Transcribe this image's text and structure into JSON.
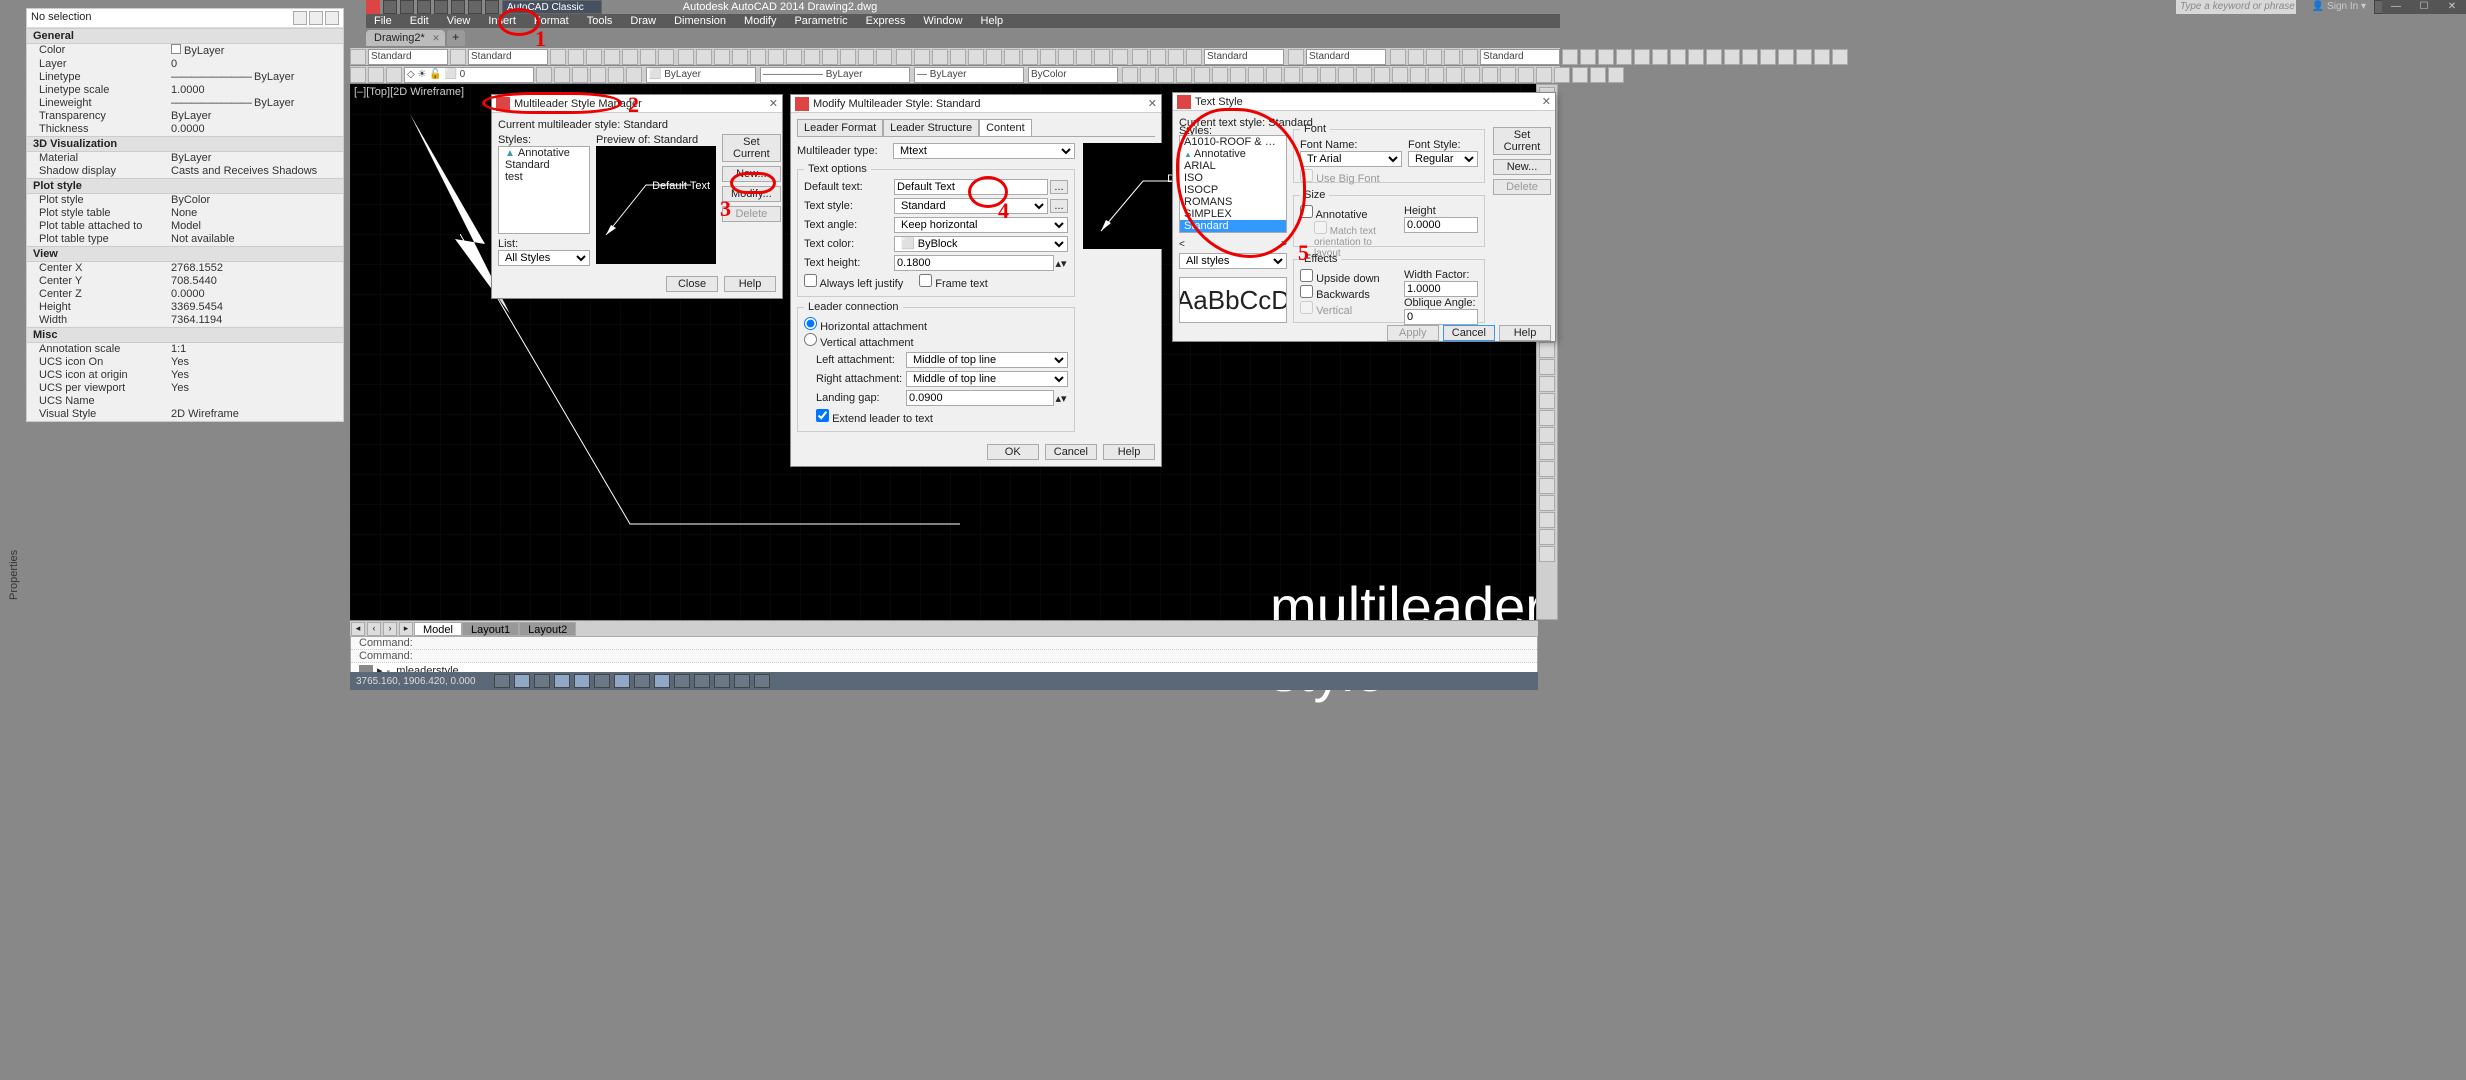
{
  "app": {
    "title": "Autodesk AutoCAD 2014   Drawing2.dwg",
    "workspace": "AutoCAD Classic",
    "search_placeholder": "Type a keyword or phrase",
    "signin": "Sign In"
  },
  "menu": [
    "File",
    "Edit",
    "View",
    "Insert",
    "Format",
    "Tools",
    "Draw",
    "Dimension",
    "Modify",
    "Parametric",
    "Express",
    "Window",
    "Help"
  ],
  "doc_tab": "Drawing2*",
  "toolbar": {
    "style_selects": [
      "Standard",
      "Standard",
      "Standard",
      "Standard",
      "Standard"
    ],
    "layer": "0",
    "bylayer": "ByLayer",
    "bylayer2": "ByLayer",
    "bylayer3": "ByLayer",
    "bycolor": "ByColor"
  },
  "viewport_label": "[–][Top][2D Wireframe]",
  "props": {
    "selection": "No selection",
    "groups": [
      {
        "name": "General",
        "rows": [
          [
            "Color",
            "ByLayer"
          ],
          [
            "Layer",
            "0"
          ],
          [
            "Linetype",
            "ByLayer"
          ],
          [
            "Linetype scale",
            "1.0000"
          ],
          [
            "Lineweight",
            "ByLayer"
          ],
          [
            "Transparency",
            "ByLayer"
          ],
          [
            "Thickness",
            "0.0000"
          ]
        ]
      },
      {
        "name": "3D Visualization",
        "rows": [
          [
            "Material",
            "ByLayer"
          ],
          [
            "Shadow display",
            "Casts and Receives Shadows"
          ]
        ]
      },
      {
        "name": "Plot style",
        "rows": [
          [
            "Plot style",
            "ByColor"
          ],
          [
            "Plot style table",
            "None"
          ],
          [
            "Plot table attached to",
            "Model"
          ],
          [
            "Plot table type",
            "Not available"
          ]
        ]
      },
      {
        "name": "View",
        "rows": [
          [
            "Center X",
            "2768.1552"
          ],
          [
            "Center Y",
            "708.5440"
          ],
          [
            "Center Z",
            "0.0000"
          ],
          [
            "Height",
            "3369.5454"
          ],
          [
            "Width",
            "7364.1194"
          ]
        ]
      },
      {
        "name": "Misc",
        "rows": [
          [
            "Annotation scale",
            "1:1"
          ],
          [
            "UCS icon On",
            "Yes"
          ],
          [
            "UCS icon at origin",
            "Yes"
          ],
          [
            "UCS per viewport",
            "Yes"
          ],
          [
            "UCS Name",
            ""
          ],
          [
            "Visual Style",
            "2D Wireframe"
          ]
        ]
      }
    ]
  },
  "props_side_label": "Properties",
  "model_tabs": [
    "Model",
    "Layout1",
    "Layout2"
  ],
  "cmdline": {
    "hist1": "Command:",
    "hist2": "Command:",
    "input": "-_mleaderstyle"
  },
  "statusbar_coords": "3765.160, 1906.420, 0.000",
  "big_text": "multileader style",
  "dlg_msm": {
    "title": "Multileader Style Manager",
    "current_label": "Current multileader style: Standard",
    "styles_label": "Styles:",
    "preview_label": "Preview of: Standard",
    "tree": [
      "Annotative",
      "Standard",
      "test"
    ],
    "list_label": "List:",
    "list_value": "All Styles",
    "preview_text": "Default Text",
    "btn_set_current": "Set Current",
    "btn_new": "New...",
    "btn_modify": "Modify...",
    "btn_delete": "Delete",
    "btn_close": "Close",
    "btn_help": "Help"
  },
  "dlg_modify": {
    "title": "Modify Multileader Style: Standard",
    "tabs": [
      "Leader Format",
      "Leader Structure",
      "Content"
    ],
    "active_tab": 2,
    "ml_type_label": "Multileader type:",
    "ml_type": "Mtext",
    "txt_options": "Text options",
    "default_text_label": "Default text:",
    "default_text": "Default Text",
    "text_style_label": "Text style:",
    "text_style": "Standard",
    "text_angle_label": "Text angle:",
    "text_angle": "Keep horizontal",
    "text_color_label": "Text color:",
    "text_color": "ByBlock",
    "text_height_label": "Text height:",
    "text_height": "0.1800",
    "always_left": "Always left justify",
    "frame_text": "Frame text",
    "leader_conn": "Leader connection",
    "horiz_attach": "Horizontal attachment",
    "vert_attach": "Vertical attachment",
    "left_attach_label": "Left attachment:",
    "left_attach": "Middle of top line",
    "right_attach_label": "Right attachment:",
    "right_attach": "Middle of top line",
    "landing_gap_label": "Landing gap:",
    "landing_gap": "0.0900",
    "extend_leader": "Extend leader to text",
    "preview_text": "Default Text",
    "btn_ok": "OK",
    "btn_cancel": "Cancel",
    "btn_help": "Help"
  },
  "dlg_textstyle": {
    "title": "Text Style",
    "current_label": "Current text style: Standard",
    "styles_label": "Styles:",
    "styles": [
      "A1010-ROOF & SITE PLA...",
      "Annotative",
      "ARIAL",
      "ISO",
      "ISOCP",
      "ROMANS",
      "SIMPLEX",
      "Standard"
    ],
    "selected_style": "Standard",
    "list_label": "All styles",
    "preview": "AaBbCcD",
    "font_group": "Font",
    "font_name_label": "Font Name:",
    "font_name": "Arial",
    "font_style_label": "Font Style:",
    "font_style": "Regular",
    "use_big_font": "Use Big Font",
    "size_group": "Size",
    "annotative": "Annotative",
    "match_orient": "Match text orientation to layout",
    "height_label": "Height",
    "height": "0.0000",
    "effects_group": "Effects",
    "upside_down": "Upside down",
    "backwards": "Backwards",
    "vertical": "Vertical",
    "width_factor_label": "Width Factor:",
    "width_factor": "1.0000",
    "oblique_label": "Oblique Angle:",
    "oblique": "0",
    "btn_set_current": "Set Current",
    "btn_new": "New...",
    "btn_delete": "Delete",
    "btn_apply": "Apply",
    "btn_cancel": "Cancel",
    "btn_help": "Help"
  },
  "annotations": {
    "n1": "1",
    "n2": "2",
    "n3": "3",
    "n4": "4",
    "n5": "5"
  }
}
